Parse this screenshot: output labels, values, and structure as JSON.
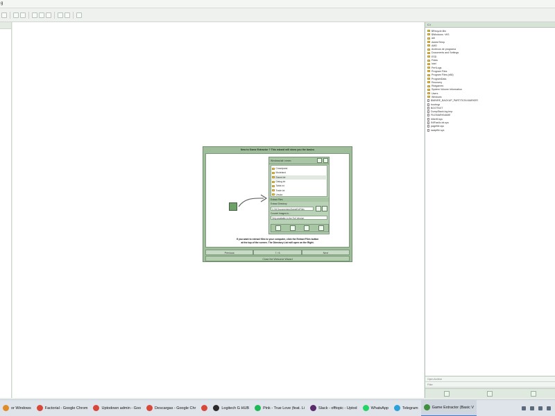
{
  "window": {
    "title_fragment": "g"
  },
  "right_panel": {
    "drive": "C:\\",
    "items": [
      {
        "label": "$Recycle.Bin",
        "kind": "folder"
      },
      {
        "label": "$Windows.~WS",
        "kind": "folder"
      },
      {
        "label": "adi",
        "kind": "folder"
      },
      {
        "label": "AdobeTemp",
        "kind": "folder"
      },
      {
        "label": "AMD",
        "kind": "folder"
      },
      {
        "label": "Archivos de programa",
        "kind": "folder"
      },
      {
        "label": "Documents and Settings",
        "kind": "folder"
      },
      {
        "label": "ESD",
        "kind": "folder"
      },
      {
        "label": "Fiddo",
        "kind": "folder"
      },
      {
        "label": "Intel",
        "kind": "folder"
      },
      {
        "label": "PerfLogs",
        "kind": "folder"
      },
      {
        "label": "Program Files",
        "kind": "folder"
      },
      {
        "label": "Program Files (x86)",
        "kind": "folder"
      },
      {
        "label": "ProgramData",
        "kind": "folder"
      },
      {
        "label": "Recovery",
        "kind": "folder"
      },
      {
        "label": "Riotgames",
        "kind": "folder"
      },
      {
        "label": "System Volume Information",
        "kind": "folder"
      },
      {
        "label": "Users",
        "kind": "folder"
      },
      {
        "label": "Windows",
        "kind": "folder"
      },
      {
        "label": "$WINRE_BACKUP_PARTITION.MARKER",
        "kind": "file"
      },
      {
        "label": "bootmgr",
        "kind": "file"
      },
      {
        "label": "BOOTNXT",
        "kind": "file"
      },
      {
        "label": "DumpStack.log.tmp",
        "kind": "file"
      },
      {
        "label": "FILEMARKNAME",
        "kind": "file"
      },
      {
        "label": "hiberfil.sys",
        "kind": "file"
      },
      {
        "label": "INIFastIo.txt.sys",
        "kind": "file"
      },
      {
        "label": "pagefile.sys",
        "kind": "file"
      },
      {
        "label": "swapfile.sys",
        "kind": "file"
      }
    ],
    "field1": "Open Archive",
    "field2": "Filter"
  },
  "wizard": {
    "title": "New to Game Extractor ? This wizard will show you the basics",
    "panel_header": "Windows/all r.mmm",
    "list_items": [
      {
        "label": "Crowdpand",
        "selected": false
      },
      {
        "label": "Modeland",
        "selected": false
      },
      {
        "label": "Sound.txt",
        "selected": true
      },
      {
        "label": "Dialog.txt",
        "selected": false
      },
      {
        "label": "Table.txt",
        "selected": false
      },
      {
        "label": "Trade.txt",
        "selected": false
      },
      {
        "label": "Ursula",
        "selected": false
      }
    ],
    "extract_label": "Extract Files",
    "extract_dir_label": "Extract Directory",
    "extract_dir_value": "C:\\Ni Documentos\\GameExtFiles",
    "convert_label": "Convert Images to...",
    "convert_value": "Only available in the Full Version",
    "help_text_line1": "If you want to extract files to your computer, click the Extract Files button",
    "help_text_line2": "at the top of the screen. The Directory List will open on the Right.",
    "nav_prev": "Previous",
    "nav_page": "7 / 8",
    "nav_next": "Next",
    "close_label": "Close the Welcome Wizard"
  },
  "taskbar": {
    "items": [
      {
        "label": "or Windows",
        "color": "#e08a2a",
        "active": false
      },
      {
        "label": "Factorial - Google Chrom",
        "color": "#d8483a",
        "active": false
      },
      {
        "label": "Uptodown admin - Goo",
        "color": "#d8483a",
        "active": false
      },
      {
        "label": "Descargas - Google Chr",
        "color": "#d8483a",
        "active": false
      },
      {
        "label": "",
        "color": "#d8483a",
        "active": false
      },
      {
        "label": "Logitech G HUB",
        "color": "#2b2b2b",
        "active": false
      },
      {
        "label": "Pink - True Love (feat. Li",
        "color": "#1db954",
        "active": false
      },
      {
        "label": "Slack - offtopic - Uptod",
        "color": "#5b2a6b",
        "active": false
      },
      {
        "label": "WhatsApp",
        "color": "#25d366",
        "active": false
      },
      {
        "label": "Telegram",
        "color": "#2aa1da",
        "active": false
      },
      {
        "label": "Game Extractor (Basic V",
        "color": "#3f8f3f",
        "active": true
      }
    ]
  }
}
